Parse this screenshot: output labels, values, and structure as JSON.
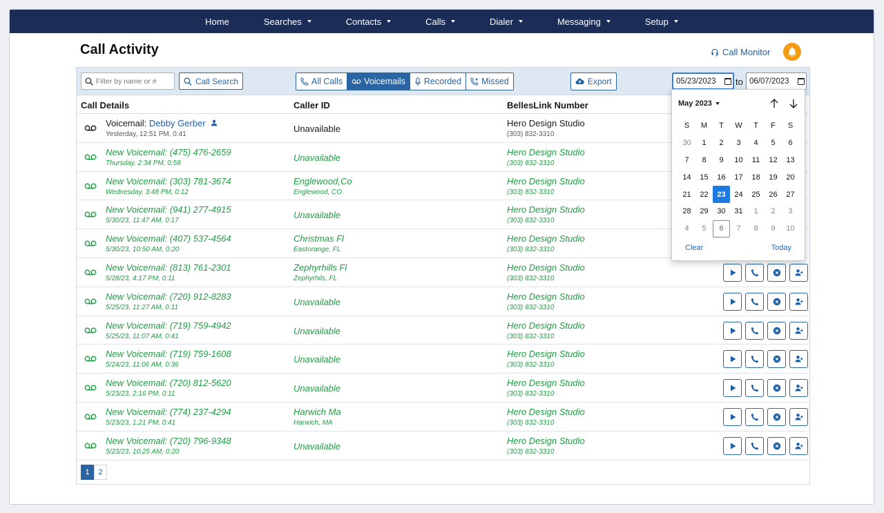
{
  "nav": [
    "Home",
    "Searches",
    "Contacts",
    "Calls",
    "Dialer",
    "Messaging",
    "Setup"
  ],
  "page": {
    "title": "Call Activity",
    "call_monitor": "Call Monitor"
  },
  "toolbar": {
    "filter_placeholder": "Filter by name or #",
    "call_search": "Call Search",
    "tabs": [
      "All Calls",
      "Voicemails",
      "Recorded",
      "Missed"
    ],
    "active_tab": "Voicemails",
    "export": "Export",
    "date_from": "05/23/2023",
    "to": "to",
    "date_to": "06/07/2023"
  },
  "table": {
    "headers": [
      "Call Details",
      "Caller ID",
      "BellesLink Number"
    ],
    "first_row": {
      "prefix": "Voicemail:",
      "name": "Debby Gerber",
      "meta": "Yesterday, 12:51 PM,  0:41",
      "caller_id": "Unavailable",
      "number_name": "Hero Design Studio",
      "number": "(303) 832-3310"
    },
    "rows": [
      {
        "title": "New Voicemail: (475) 476-2659",
        "meta": "Thursday, 2:34 PM,  0:58",
        "caller": "Unavailable",
        "caller_loc": "",
        "number_name": "Hero Design Studio",
        "number": "(303) 832-3310"
      },
      {
        "title": "New Voicemail: (303) 781-3674",
        "meta": "Wednesday, 3:48 PM,  0:12",
        "caller": "Englewood,Co",
        "caller_loc": "Englewood, CO",
        "number_name": "Hero Design Studio",
        "number": "(303) 832-3310"
      },
      {
        "title": "New Voicemail: (941) 277-4915",
        "meta": "5/30/23, 11:47 AM,  0:17",
        "caller": "Unavailable",
        "caller_loc": "",
        "number_name": "Hero Design Studio",
        "number": "(303) 832-3310"
      },
      {
        "title": "New Voicemail: (407) 537-4564",
        "meta": "5/30/23, 10:50 AM,  0:20",
        "caller": "Christmas Fl",
        "caller_loc": "Eastorange, FL",
        "number_name": "Hero Design Studio",
        "number": "(303) 832-3310"
      },
      {
        "title": "New Voicemail: (813) 761-2301",
        "meta": "5/28/23, 4:17 PM,  0:11",
        "caller": "Zephyrhills Fl",
        "caller_loc": "Zephyrhils, FL",
        "number_name": "Hero Design Studio",
        "number": "(303) 832-3310"
      },
      {
        "title": "New Voicemail: (720) 912-8283",
        "meta": "5/25/23, 11:27 AM,  0:11",
        "caller": "Unavailable",
        "caller_loc": "",
        "number_name": "Hero Design Studio",
        "number": "(303) 832-3310"
      },
      {
        "title": "New Voicemail: (719) 759-4942",
        "meta": "5/25/23, 11:07 AM,  0:41",
        "caller": "Unavailable",
        "caller_loc": "",
        "number_name": "Hero Design Studio",
        "number": "(303) 832-3310"
      },
      {
        "title": "New Voicemail: (719) 759-1608",
        "meta": "5/24/23, 11:06 AM,  0:36",
        "caller": "Unavailable",
        "caller_loc": "",
        "number_name": "Hero Design Studio",
        "number": "(303) 832-3310"
      },
      {
        "title": "New Voicemail: (720) 812-5620",
        "meta": "5/23/23, 2:16 PM,  0:11",
        "caller": "Unavailable",
        "caller_loc": "",
        "number_name": "Hero Design Studio",
        "number": "(303) 832-3310"
      },
      {
        "title": "New Voicemail: (774) 237-4294",
        "meta": "5/23/23, 1:21 PM,  0:41",
        "caller": "Harwich Ma",
        "caller_loc": "Harwich, MA",
        "number_name": "Hero Design Studio",
        "number": "(303) 832-3310"
      },
      {
        "title": "New Voicemail: (720) 796-9348",
        "meta": "5/23/23, 10:25 AM,  0:20",
        "caller": "Unavailable",
        "caller_loc": "",
        "number_name": "Hero Design Studio",
        "number": "(303) 832-3310"
      }
    ],
    "action_rows_start": 5
  },
  "pagination": [
    "1",
    "2"
  ],
  "datepicker": {
    "month": "May 2023",
    "weekdays": [
      "S",
      "M",
      "T",
      "W",
      "T",
      "F",
      "S"
    ],
    "days": [
      "30",
      "1",
      "2",
      "3",
      "4",
      "5",
      "6",
      "7",
      "8",
      "9",
      "10",
      "11",
      "12",
      "13",
      "14",
      "15",
      "16",
      "17",
      "18",
      "19",
      "20",
      "21",
      "22",
      "23",
      "24",
      "25",
      "26",
      "27",
      "28",
      "29",
      "30",
      "31",
      "1",
      "2",
      "3",
      "4",
      "5",
      "6",
      "7",
      "8",
      "9",
      "10"
    ],
    "selected_day": "23",
    "today_day": "6",
    "clear": "Clear",
    "today": "Today"
  },
  "colors": {
    "nav_bg": "#1b2c57",
    "accent": "#2b64a3",
    "new_voicemail": "#1e9e43",
    "bell": "#f39c12",
    "selected": "#1c7ae0"
  }
}
